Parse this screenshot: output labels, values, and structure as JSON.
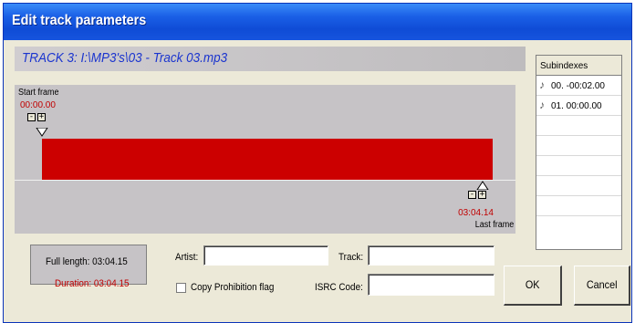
{
  "window": {
    "title": "Edit track parameters"
  },
  "track": {
    "header": "TRACK 3: I:\\MP3's\\03 - Track 03.mp3"
  },
  "frames": {
    "start_label": "Start frame",
    "start_time": "00:00.00",
    "end_time": "03:04.14",
    "last_label": "Last frame",
    "stepper_minus": "-",
    "stepper_plus": "+"
  },
  "subindexes": {
    "header": "Subindexes",
    "items": [
      {
        "label": "00. -00:02.00"
      },
      {
        "label": "01. 00:00.00"
      }
    ]
  },
  "info": {
    "full_length": "Full length: 03:04.15",
    "duration": "Duration: 03:04.15"
  },
  "fields": {
    "artist_label": "Artist:",
    "artist_value": "",
    "track_label": "Track:",
    "track_value": "",
    "isrc_label": "ISRC Code:",
    "isrc_value": "",
    "copy_flag_label": "Copy Prohibition flag",
    "copy_flag_checked": false
  },
  "buttons": {
    "ok": "OK",
    "cancel": "Cancel"
  },
  "colors": {
    "titlebar": "#0f4cd6",
    "track_text": "#1a34cf",
    "time_red": "#c00000",
    "range_bar": "#cc0000",
    "panel_gray": "#c6c3c6",
    "dialog_bg": "#ece9d8"
  }
}
